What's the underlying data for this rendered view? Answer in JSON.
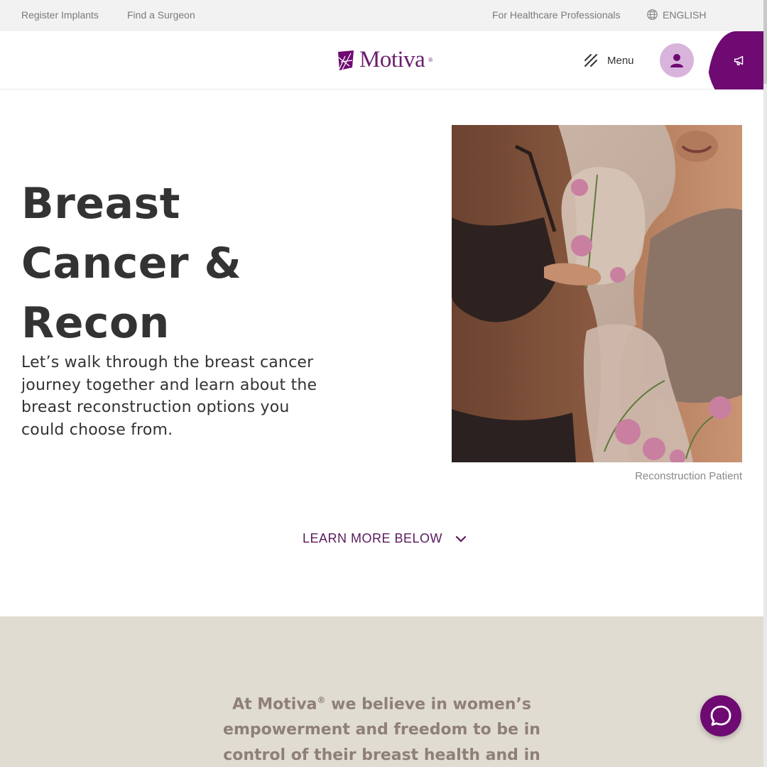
{
  "topbar": {
    "register_implants": "Register Implants",
    "find_surgeon": "Find a Surgeon",
    "healthcare": "For Healthcare Professionals",
    "language": "ENGLISH"
  },
  "header": {
    "logo_text": "Motiva",
    "logo_mark": "®",
    "menu_label": "Menu"
  },
  "hero": {
    "title_lines": [
      "Breast",
      "Cancer &",
      "Recon"
    ],
    "subtitle": "Let’s walk through the breast cancer journey together and learn about the breast reconstruction options you could choose from.",
    "image_caption": "Reconstruction Patient",
    "learn_more": "LEARN MORE BELOW"
  },
  "belief": {
    "prefix": "At Motiva",
    "reg": "®",
    "text": " we believe in women’s empowerment and freedom to be in control of their breast health and in the"
  },
  "icons": {
    "globe": "globe-icon",
    "menu": "menu-slashes-icon",
    "account": "user-icon",
    "promo": "megaphone-icon",
    "chevron": "chevron-down-icon",
    "chat": "chat-bubble-icon"
  },
  "colors": {
    "brand_purple": "#6f0a72",
    "account_bg": "#d8b4dc",
    "beige": "#e1dcd2",
    "belief_text": "#8f8077"
  }
}
